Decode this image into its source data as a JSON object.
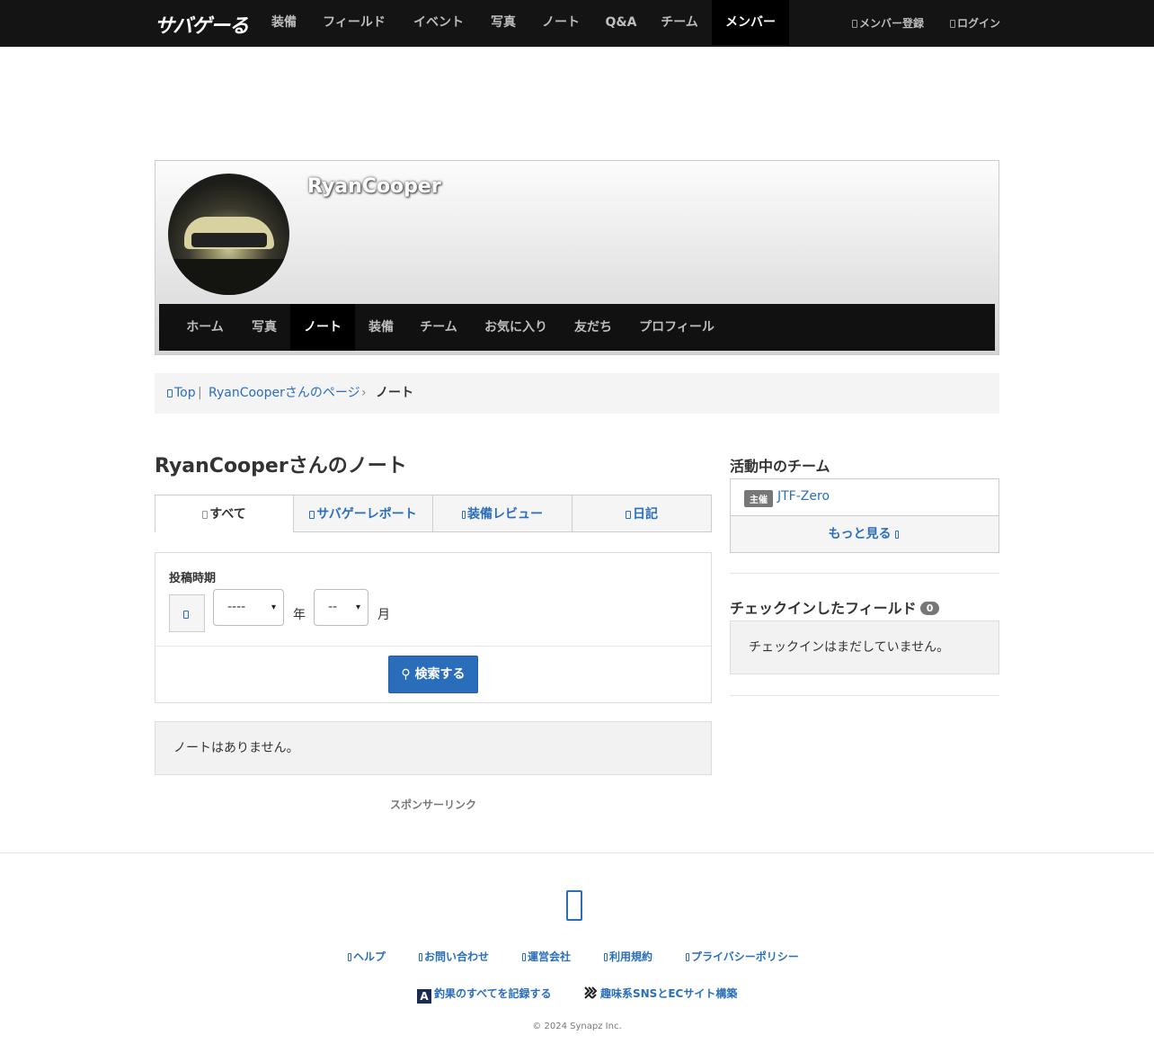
{
  "topnav": {
    "logo": "サバゲーる",
    "items": [
      {
        "label": "装備"
      },
      {
        "label": "フィールド"
      },
      {
        "label": "イベント"
      },
      {
        "label": "写真"
      },
      {
        "label": "ノート"
      },
      {
        "label": "Q&A"
      },
      {
        "label": "チーム"
      },
      {
        "label": "メンバー"
      }
    ],
    "active": "メンバー",
    "register": "メンバー登録",
    "login": "ログイン"
  },
  "profile": {
    "name": "RyanCooper",
    "tabs": [
      {
        "label": "ホーム"
      },
      {
        "label": "写真"
      },
      {
        "label": "ノート"
      },
      {
        "label": "装備"
      },
      {
        "label": "チーム"
      },
      {
        "label": "お気に入り"
      },
      {
        "label": "友だち"
      },
      {
        "label": "プロフィール"
      }
    ],
    "active_tab": "ノート"
  },
  "breadcrumb": {
    "top": "Top",
    "user_page": "RyanCooperさんのページ",
    "current": "ノート"
  },
  "main": {
    "title": "RyanCooperさんのノート",
    "category_tabs": [
      {
        "label": "すべて"
      },
      {
        "label": "サバゲーレポート"
      },
      {
        "label": "装備レビュー"
      },
      {
        "label": "日記"
      }
    ],
    "filter": {
      "label": "投稿時期",
      "year_value": "----",
      "year_unit": "年",
      "month_value": "--",
      "month_unit": "月",
      "search_label": "検索する"
    },
    "empty_message": "ノートはありません。",
    "sponsor": "スポンサーリンク"
  },
  "sidebar": {
    "teams_heading": "活動中のチーム",
    "team": {
      "badge": "主催",
      "name": "JTF-Zero"
    },
    "more": "もっと見る",
    "checkin_heading": "チェックインしたフィールド",
    "checkin_count": "0",
    "checkin_empty": "チェックインはまだしていません。"
  },
  "footer": {
    "links": [
      {
        "label": "ヘルプ"
      },
      {
        "label": "お問い合わせ"
      },
      {
        "label": "運営会社"
      },
      {
        "label": "利用規約"
      },
      {
        "label": "プライバシーポリシー"
      }
    ],
    "promo1": "釣果のすべてを記録する",
    "promo2": "趣味系SNSとECサイト構築",
    "copyright": "© 2024 Synapz Inc."
  },
  "colors": {
    "link": "#2a6ebb",
    "nav_bg": "#141414",
    "primary_button": "#2a6ebb"
  }
}
